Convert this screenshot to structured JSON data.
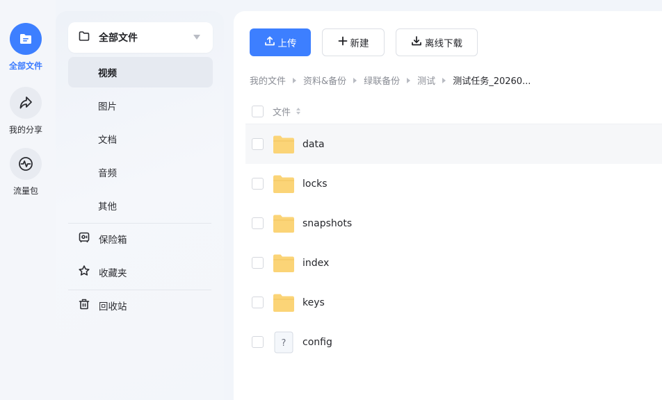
{
  "rail": {
    "items": [
      {
        "label": "全部文件",
        "icon": "folder-files-icon",
        "active": true
      },
      {
        "label": "我的分享",
        "icon": "share-arrow-icon",
        "active": false
      },
      {
        "label": "流量包",
        "icon": "traffic-pulse-icon",
        "active": false
      }
    ]
  },
  "panel": {
    "header": {
      "label": "全部文件",
      "icon": "folder-outline-icon"
    },
    "subitems": [
      {
        "label": "视频",
        "active": true
      },
      {
        "label": "图片",
        "active": false
      },
      {
        "label": "文档",
        "active": false
      },
      {
        "label": "音频",
        "active": false
      },
      {
        "label": "其他",
        "active": false
      }
    ],
    "nav": [
      {
        "label": "保险箱",
        "icon": "safe-icon"
      },
      {
        "label": "收藏夹",
        "icon": "star-icon"
      },
      {
        "label": "回收站",
        "icon": "trash-icon"
      }
    ]
  },
  "toolbar": {
    "upload_label": "上传",
    "new_label": "新建",
    "offline_label": "离线下载"
  },
  "breadcrumb": [
    "我的文件",
    "资料&备份",
    "绿联备份",
    "测试",
    "测试任务_20260..."
  ],
  "list": {
    "column_name": "文件",
    "files": [
      {
        "name": "data",
        "type": "folder"
      },
      {
        "name": "locks",
        "type": "folder"
      },
      {
        "name": "snapshots",
        "type": "folder"
      },
      {
        "name": "index",
        "type": "folder"
      },
      {
        "name": "keys",
        "type": "folder"
      },
      {
        "name": "config",
        "type": "unknown"
      }
    ]
  },
  "colors": {
    "accent": "#3d7fff",
    "folder": "#fbd477",
    "hover_row": "#f6f7f9"
  }
}
